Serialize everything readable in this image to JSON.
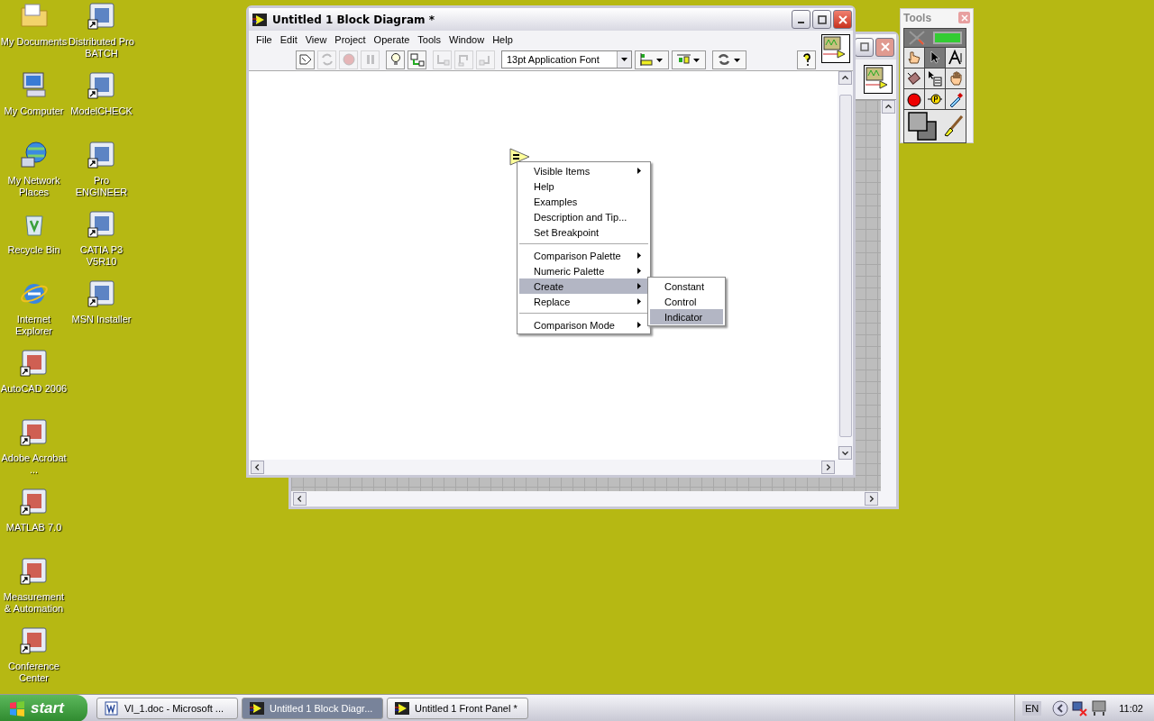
{
  "desktop": {
    "left_column": [
      {
        "label": "My Documents",
        "kind": "folder",
        "shortcut": false
      },
      {
        "label": "My Computer",
        "kind": "computer",
        "shortcut": false
      },
      {
        "label": "My Network Places",
        "kind": "network",
        "shortcut": false
      },
      {
        "label": "Recycle Bin",
        "kind": "bin",
        "shortcut": false
      },
      {
        "label": "Internet Explorer",
        "kind": "globe",
        "shortcut": false
      },
      {
        "label": "AutoCAD 2006",
        "kind": "app",
        "shortcut": true
      },
      {
        "label": "Adobe Acrobat ...",
        "kind": "app",
        "shortcut": true
      },
      {
        "label": "MATLAB 7.0",
        "kind": "app",
        "shortcut": true
      },
      {
        "label": "Measurement & Automation",
        "kind": "app",
        "shortcut": true
      },
      {
        "label": "Conference Center",
        "kind": "app",
        "shortcut": true
      }
    ],
    "right_column": [
      {
        "label": "Distributed Pro BATCH",
        "kind": "app",
        "shortcut": true
      },
      {
        "label": "ModelCHECK",
        "kind": "app",
        "shortcut": true
      },
      {
        "label": "Pro ENGINEER",
        "kind": "app",
        "shortcut": true
      },
      {
        "label": "CATIA P3 V5R10",
        "kind": "app",
        "shortcut": true
      },
      {
        "label": "MSN Installer",
        "kind": "app",
        "shortcut": true
      }
    ]
  },
  "block_diagram_window": {
    "title": "Untitled 1 Block Diagram *",
    "menu": [
      "File",
      "Edit",
      "View",
      "Project",
      "Operate",
      "Tools",
      "Window",
      "Help"
    ],
    "toolbar": [
      {
        "kind": "run",
        "disabled": false
      },
      {
        "kind": "run-continuous",
        "disabled": true
      },
      {
        "kind": "abort",
        "disabled": true
      },
      {
        "kind": "pause",
        "disabled": true
      },
      {
        "kind": "highlight",
        "disabled": false
      },
      {
        "kind": "retain",
        "disabled": false
      },
      {
        "kind": "step-into",
        "disabled": true
      },
      {
        "kind": "step-over",
        "disabled": true
      },
      {
        "kind": "step-out",
        "disabled": true
      }
    ],
    "font_select": "13pt Application Font",
    "context_menu": {
      "items": [
        {
          "label": "Visible Items",
          "submenu": true,
          "selected": false,
          "separator_before": false
        },
        {
          "label": "Help",
          "submenu": false,
          "selected": false,
          "separator_before": false
        },
        {
          "label": "Examples",
          "submenu": false,
          "selected": false,
          "separator_before": false
        },
        {
          "label": "Description and Tip...",
          "submenu": false,
          "selected": false,
          "separator_before": false
        },
        {
          "label": "Set Breakpoint",
          "submenu": false,
          "selected": false,
          "separator_before": false
        },
        {
          "label": "Comparison Palette",
          "submenu": true,
          "selected": false,
          "separator_before": true
        },
        {
          "label": "Numeric Palette",
          "submenu": true,
          "selected": false,
          "separator_before": false
        },
        {
          "label": "Create",
          "submenu": true,
          "selected": true,
          "separator_before": false
        },
        {
          "label": "Replace",
          "submenu": true,
          "selected": false,
          "separator_before": false
        },
        {
          "label": "Comparison Mode",
          "submenu": true,
          "selected": false,
          "separator_before": true
        }
      ],
      "submenu": [
        {
          "label": "Constant",
          "selected": false
        },
        {
          "label": "Control",
          "selected": false
        },
        {
          "label": "Indicator",
          "selected": true
        }
      ]
    }
  },
  "tools_palette": {
    "title": "Tools",
    "auto_tool": {
      "on": true
    },
    "tools": [
      {
        "kind": "operate",
        "selected": false
      },
      {
        "kind": "position",
        "selected": true
      },
      {
        "kind": "text",
        "selected": false
      },
      {
        "kind": "wiring",
        "selected": false
      },
      {
        "kind": "shortcut-menu",
        "selected": false
      },
      {
        "kind": "scroll",
        "selected": false
      },
      {
        "kind": "breakpoint",
        "selected": false
      },
      {
        "kind": "probe",
        "selected": false
      },
      {
        "kind": "color-copy",
        "selected": false
      }
    ]
  },
  "taskbar": {
    "start": "start",
    "tasks": [
      {
        "label": "VI_1.doc - Microsoft ...",
        "kind": "document",
        "selected": false
      },
      {
        "label": "Untitled 1 Block Diagr...",
        "kind": "vi",
        "selected": true
      },
      {
        "label": "Untitled 1 Front Panel *",
        "kind": "vi",
        "selected": false
      }
    ],
    "language": "EN",
    "clock": "11:02"
  }
}
